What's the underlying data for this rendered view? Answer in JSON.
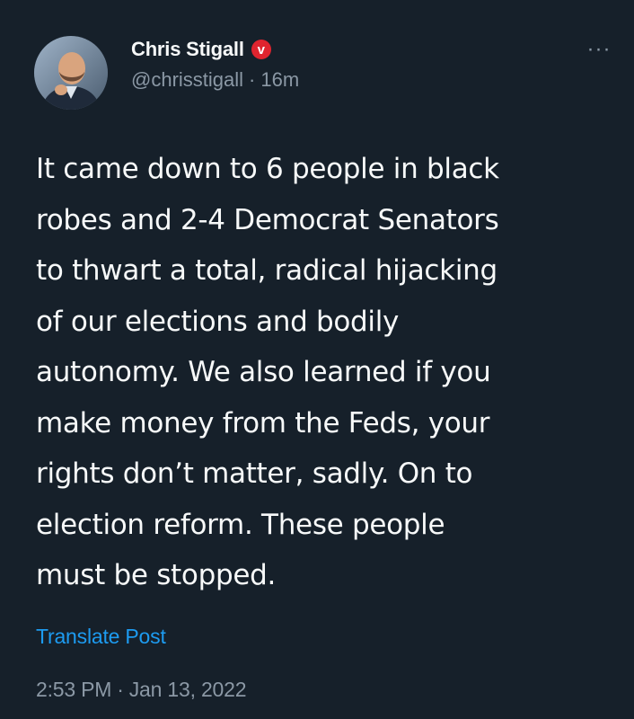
{
  "author": {
    "display_name": "Chris Stigall",
    "badge_letter": "v",
    "handle": "@chrisstigall",
    "separator": "·",
    "relative_time": "16m"
  },
  "more_icon": "more-horizontal-icon",
  "tweet": {
    "text": "It came down to 6 people in black\nrobes and 2-4 Democrat Senators\nto thwart a total, radical hijacking\nof our elections and bodily\nautonomy. We also learned if you\nmake money from the Feds, your\nrights don’t matter, sadly.  On to\nelection reform.  These people\nmust be stopped."
  },
  "translate_label": "Translate Post",
  "footer": {
    "time": "2:53 PM",
    "separator": "·",
    "date": "Jan 13, 2022"
  },
  "colors": {
    "background": "#16202a",
    "text_primary": "#f7f9f9",
    "text_secondary": "#8b98a5",
    "link": "#1d9bf0",
    "badge": "#e0242f"
  }
}
